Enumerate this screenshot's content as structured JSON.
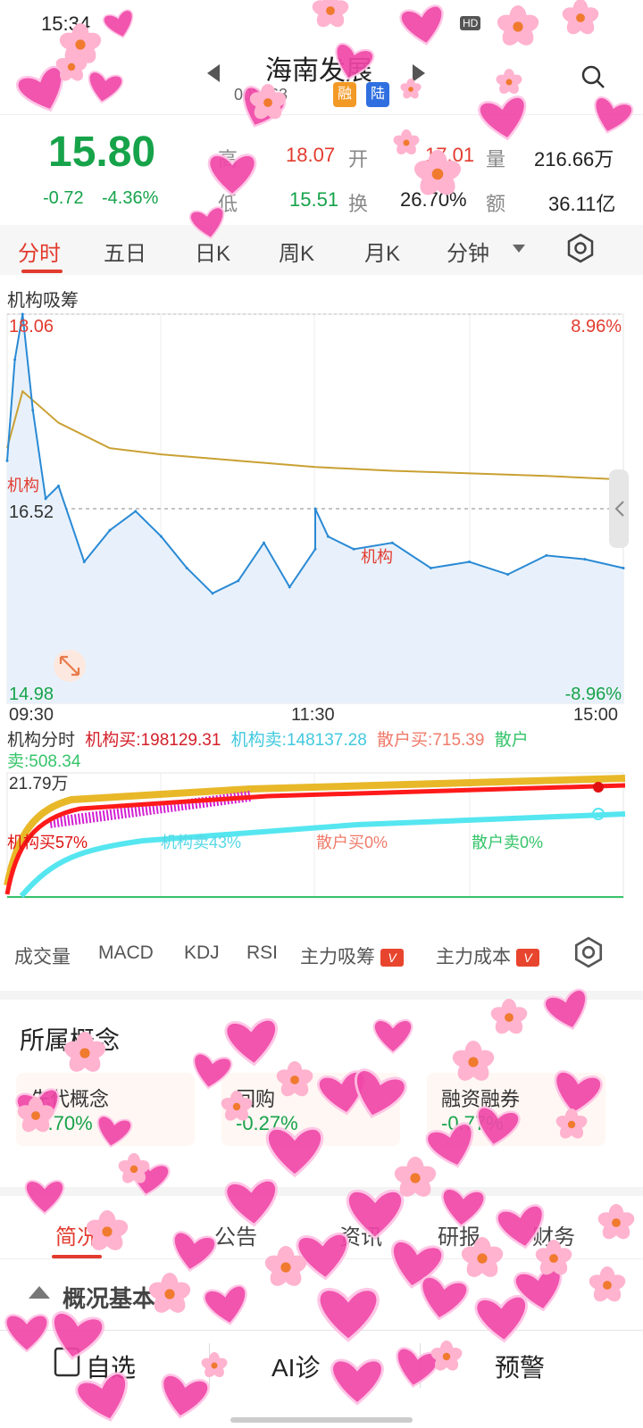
{
  "status_bar": {
    "time": "15:34",
    "hd": "HD"
  },
  "header": {
    "stock_name": "海南发展",
    "stock_code": "002163",
    "tags": [
      "融",
      "陆"
    ]
  },
  "quote": {
    "price": "15.80",
    "change": "-0.72",
    "change_pct": "-4.36%",
    "high_label": "高",
    "high_value": "18.07",
    "open_label": "开",
    "open_value": "17.01",
    "volume_label": "量",
    "volume_value": "216.66万",
    "low_label": "低",
    "low_value": "15.51",
    "turnover_label": "换",
    "turnover_value": "26.70%",
    "amount_label": "额",
    "amount_value": "36.11亿"
  },
  "tabs": [
    "分时",
    "五日",
    "日K",
    "周K",
    "月K",
    "分钟"
  ],
  "active_tab": "分时",
  "chart_title": "机构吸筹",
  "chart_labels": {
    "top_price": "18.06",
    "top_pct": "8.96%",
    "mid_price": "16.52",
    "bottom_price": "14.98",
    "bottom_pct": "-8.96%",
    "time_start": "09:30",
    "time_mid": "11:30",
    "time_end": "15:00",
    "marker_1": "机构",
    "marker_2": "机构"
  },
  "institution_legend": {
    "label": "机构分时",
    "buy": "机构买:198129.31",
    "sell": "机构卖:148137.28",
    "retail_buy": "散户买:715.39",
    "retail_sell": "散户卖:508.34"
  },
  "institution_chart": {
    "max_label": "21.79万",
    "buy_pct": "机构买57%",
    "sell_pct": "机构卖43%",
    "retail_buy_pct": "散户买0%",
    "retail_sell_pct": "散户卖0%"
  },
  "indicators": [
    "成交量",
    "MACD",
    "KDJ",
    "RSI",
    "主力吸筹",
    "主力成本"
  ],
  "vip_tag": "V",
  "concepts": {
    "title": "所属概念",
    "items": [
      {
        "name": "先代概念",
        "value": "-0.70%"
      },
      {
        "name": "回购",
        "value": "-0.27%"
      },
      {
        "name": "融资融券",
        "value": "-0.77%"
      }
    ]
  },
  "section_tabs": [
    "简况",
    "公告",
    "资讯",
    "研报",
    "财务"
  ],
  "overview_title": "概况基本",
  "bottom_bar": [
    "自选",
    "AI诊",
    "预警"
  ],
  "colors": {
    "up_red": "#e23b2e",
    "down_green": "#16a34a",
    "price_line": "#2a8ad4",
    "avg_line": "#c9a032",
    "inst_buy": "#ff1a1a",
    "inst_sell": "#55e6f0",
    "accent": "#e23b2e"
  },
  "chart_data": {
    "type": "line",
    "title": "机构吸筹",
    "x_range": [
      "09:30",
      "15:00"
    ],
    "ylim": [
      14.98,
      18.06
    ],
    "prev_close": 16.52,
    "series": [
      {
        "name": "",
        "x": [
          "09:30",
          "09:33",
          "09:36",
          "09:40",
          "09:45",
          "09:50",
          "10:00",
          "10:10",
          "10:20",
          "10:30",
          "10:40",
          "10:50",
          "11:00",
          "11:10",
          "11:20",
          "11:30",
          "13:00",
          "13:05",
          "13:15",
          "13:30",
          "13:45",
          "14:00",
          "14:15",
          "14:30",
          "14:45",
          "15:00"
        ],
        "values": [
          16.9,
          17.7,
          18.06,
          17.3,
          16.6,
          16.7,
          16.1,
          16.35,
          16.5,
          16.3,
          16.05,
          15.85,
          15.95,
          16.25,
          15.9,
          16.2,
          16.52,
          16.3,
          16.2,
          16.25,
          16.05,
          16.1,
          16.0,
          16.15,
          16.12,
          16.05
        ]
      },
      {
        "name": "",
        "x": [
          "09:30",
          "09:36",
          "09:50",
          "10:10",
          "10:30",
          "11:00",
          "11:30",
          "13:30",
          "14:30",
          "15:00"
        ],
        "values": [
          17.0,
          17.45,
          17.2,
          17.0,
          16.95,
          16.9,
          16.85,
          16.82,
          16.78,
          16.75
        ]
      }
    ]
  }
}
